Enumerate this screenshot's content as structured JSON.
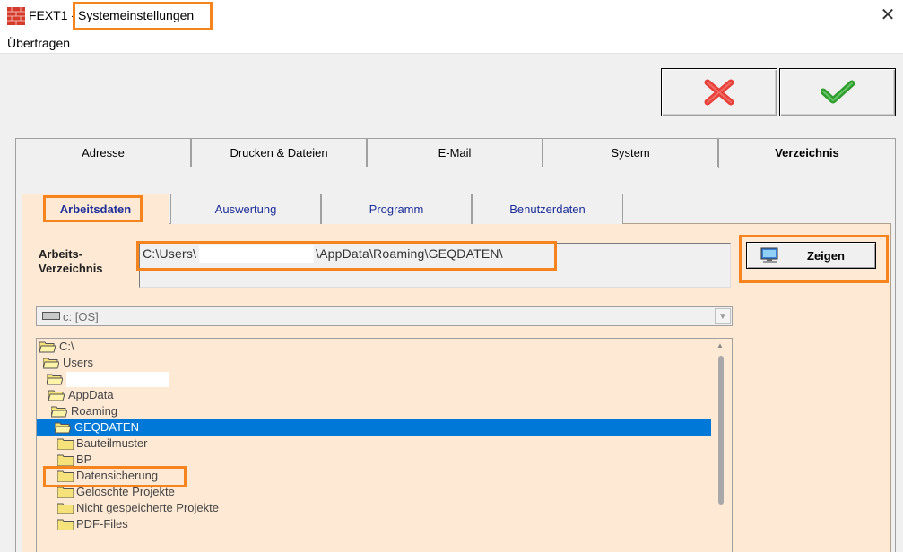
{
  "window": {
    "app_name": "FEXT1 -",
    "title": "Systemeinstellungen",
    "close_glyph": "✕"
  },
  "menu": {
    "items": [
      "Übertragen"
    ]
  },
  "toolbar": {
    "cancel_icon": "red-x-icon",
    "ok_icon": "green-check-icon"
  },
  "outer_tabs": [
    {
      "label": "Adresse"
    },
    {
      "label": "Drucken & Dateien"
    },
    {
      "label": "E-Mail"
    },
    {
      "label": "System"
    },
    {
      "label": "Verzeichnis",
      "active": true
    }
  ],
  "inner_tabs": [
    {
      "label": "Arbeitsdaten",
      "active": true
    },
    {
      "label": "Auswertung"
    },
    {
      "label": "Programm"
    },
    {
      "label": "Benutzerdaten"
    }
  ],
  "work_dir": {
    "label_line1": "Arbeits-",
    "label_line2": "Verzeichnis",
    "path_start": "C:\\Users\\",
    "path_end": "\\AppData\\Roaming\\GEQDATEN\\",
    "show_button": "Zeigen"
  },
  "drive": {
    "selected": "c: [OS]"
  },
  "folders": [
    {
      "name": "C:\\"
    },
    {
      "name": "Users"
    },
    {
      "name": ""
    },
    {
      "name": "AppData"
    },
    {
      "name": "Roaming"
    },
    {
      "name": "GEQDATEN",
      "selected": true
    },
    {
      "name": "Bauteilmuster"
    },
    {
      "name": "BP"
    },
    {
      "name": "Datensicherung"
    },
    {
      "name": "Geloschte Projekte"
    },
    {
      "name": "Nicht gespeicherte Projekte"
    },
    {
      "name": "PDF-Files"
    }
  ],
  "colors": {
    "highlight": "#f5841f",
    "selection": "#0078d7",
    "panel": "#fde9d4"
  }
}
